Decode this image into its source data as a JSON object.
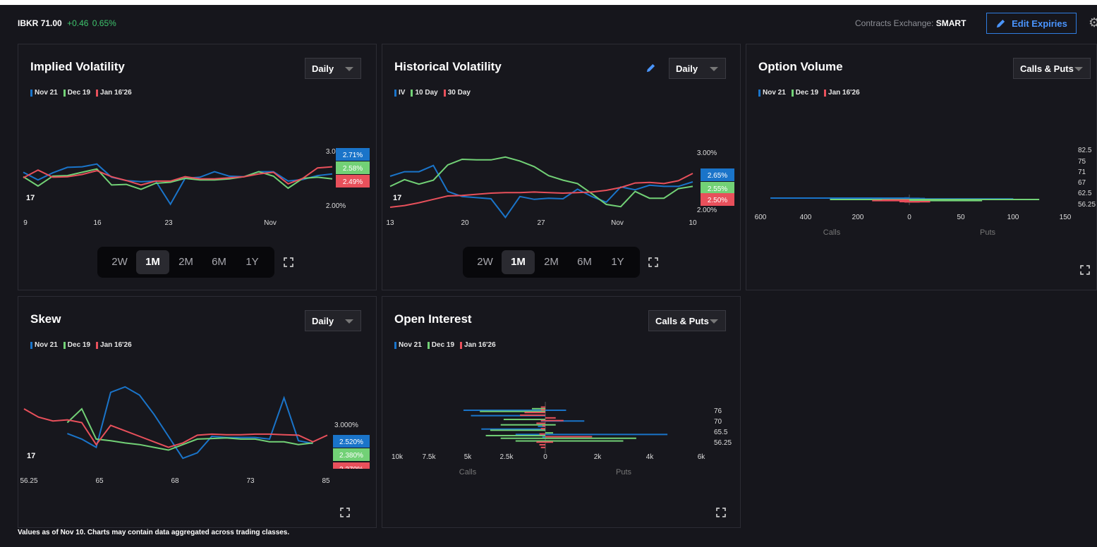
{
  "ticker": {
    "symbol": "IBKR",
    "price": "71.00",
    "change": "+0.46",
    "change_pct": "0.65%"
  },
  "exchange": {
    "label": "Contracts Exchange:",
    "value": "SMART"
  },
  "edit_expiries": "Edit Expiries",
  "footer": "Values as of Nov 10. Charts may contain data aggregated across trading classes.",
  "colors": {
    "blue": "#1a74c9",
    "green": "#72d176",
    "red": "#e8505b",
    "background": "#16161c"
  },
  "icons": [
    "pencil-icon",
    "gear-icon",
    "caret-down-icon",
    "expand-icon",
    "tradingview-logo"
  ],
  "panels": {
    "iv": {
      "title": "Implied Volatility",
      "dropdown": "Daily",
      "legend": [
        "Nov 21",
        "Dec 19",
        "Jan 16'26"
      ],
      "ranges": [
        "2W",
        "1M",
        "2M",
        "6M",
        "1Y"
      ],
      "active_range": "1M"
    },
    "hv": {
      "title": "Historical Volatility",
      "dropdown": "Daily",
      "legend": [
        "IV",
        "10 Day",
        "30 Day"
      ],
      "ranges": [
        "2W",
        "1M",
        "2M",
        "6M",
        "1Y"
      ],
      "active_range": "1M"
    },
    "ov": {
      "title": "Option Volume",
      "dropdown": "Calls & Puts",
      "legend": [
        "Nov 21",
        "Dec 19",
        "Jan 16'26"
      ]
    },
    "skew": {
      "title": "Skew",
      "dropdown": "Daily",
      "legend": [
        "Nov 21",
        "Dec 19",
        "Jan 16'26"
      ]
    },
    "oi": {
      "title": "Open Interest",
      "dropdown": "Calls & Puts",
      "legend": [
        "Nov 21",
        "Dec 19",
        "Jan 16'26"
      ]
    }
  },
  "chart_data": [
    {
      "id": "iv",
      "type": "line",
      "title": "Implied Volatility",
      "x_ticks": [
        "9",
        "16",
        "23",
        "Nov"
      ],
      "y_ticks": [
        "3.00%",
        "2.00%"
      ],
      "last_labels": [
        "2.71%",
        "2.58%",
        "2.49%"
      ],
      "series": [
        {
          "name": "Nov 21",
          "color": "#1a74c9",
          "values": [
            2.61,
            2.47,
            2.6,
            2.7,
            2.71,
            2.76,
            2.52,
            2.46,
            2.44,
            2.45,
            2.03,
            2.5,
            2.52,
            2.62,
            2.54,
            2.53,
            2.62,
            2.62,
            2.45,
            2.48,
            2.55,
            2.58
          ]
        },
        {
          "name": "Dec 19",
          "color": "#72d176",
          "values": [
            2.53,
            2.36,
            2.54,
            2.55,
            2.61,
            2.67,
            2.38,
            2.39,
            2.3,
            2.41,
            2.43,
            2.5,
            2.47,
            2.47,
            2.49,
            2.53,
            2.62,
            2.54,
            2.32,
            2.5,
            2.52,
            2.49
          ]
        },
        {
          "name": "Jan 16'26",
          "color": "#e8505b",
          "values": [
            2.51,
            2.65,
            2.52,
            2.53,
            2.57,
            2.64,
            2.53,
            2.46,
            2.38,
            2.45,
            2.45,
            2.53,
            2.49,
            2.49,
            2.51,
            2.53,
            2.58,
            2.61,
            2.4,
            2.5,
            2.69,
            2.71
          ]
        }
      ]
    },
    {
      "id": "hv",
      "type": "line",
      "title": "Historical Volatility",
      "x_ticks": [
        "13",
        "20",
        "27",
        "Nov",
        "10"
      ],
      "y_ticks": [
        "3.00%",
        "2.00%"
      ],
      "last_labels": [
        "2.65%",
        "2.55%",
        "2.50%"
      ],
      "series": [
        {
          "name": "IV",
          "color": "#1a74c9",
          "values": [
            2.6,
            2.68,
            2.68,
            2.79,
            2.33,
            2.24,
            2.22,
            2.2,
            1.87,
            2.24,
            2.19,
            2.21,
            2.2,
            2.37,
            2.24,
            2.14,
            2.41,
            2.36,
            2.44,
            2.42,
            2.42,
            2.5
          ]
        },
        {
          "name": "10 Day",
          "color": "#72d176",
          "values": [
            2.42,
            2.54,
            2.46,
            2.53,
            2.8,
            2.9,
            2.89,
            2.89,
            2.94,
            2.87,
            2.77,
            2.61,
            2.53,
            2.47,
            2.29,
            2.1,
            2.06,
            2.33,
            2.21,
            2.21,
            2.38,
            2.42
          ]
        },
        {
          "name": "30 Day",
          "color": "#e8505b",
          "values": [
            2.05,
            2.08,
            2.13,
            2.19,
            2.25,
            2.26,
            2.28,
            2.3,
            2.31,
            2.31,
            2.32,
            2.31,
            2.3,
            2.31,
            2.32,
            2.35,
            2.4,
            2.48,
            2.49,
            2.47,
            2.52,
            2.65
          ]
        }
      ]
    },
    {
      "id": "ov",
      "type": "bar",
      "title": "Option Volume",
      "orientation": "horizontal",
      "x_ticks_calls": [
        "600",
        "400",
        "200",
        "0"
      ],
      "x_ticks_puts": [
        "50",
        "100",
        "150"
      ],
      "strike_labels": [
        "82.5",
        "75",
        "71",
        "67",
        "62.5",
        "56.25"
      ],
      "xlabel_left": "Calls",
      "xlabel_right": "Puts",
      "calls_max": 600,
      "puts_max": 150,
      "strikes": [
        82.5,
        80,
        77.5,
        75,
        72.5,
        71,
        70,
        69,
        68,
        67,
        66,
        65,
        64,
        62.5,
        60,
        56.25
      ],
      "series": [
        {
          "name": "Nov 21",
          "color": "#1a74c9",
          "calls": [
            0,
            0,
            20,
            560,
            40,
            30,
            10,
            10,
            0,
            5,
            10,
            5,
            10,
            0,
            0,
            0
          ],
          "puts": [
            0,
            0,
            0,
            0,
            0,
            10,
            15,
            5,
            5,
            100,
            10,
            60,
            45,
            10,
            0,
            0
          ]
        },
        {
          "name": "Dec 19",
          "color": "#72d176",
          "calls": [
            0,
            0,
            0,
            0,
            0,
            320,
            0,
            0,
            0,
            0,
            0,
            0,
            70,
            0,
            0,
            0
          ],
          "puts": [
            0,
            0,
            0,
            0,
            0,
            125,
            20,
            0,
            0,
            0,
            0,
            0,
            50,
            70,
            0,
            0
          ]
        },
        {
          "name": "Jan 16'26",
          "color": "#e8505b",
          "calls": [
            0,
            80,
            110,
            20,
            0,
            150,
            0,
            0,
            10,
            0,
            5,
            0,
            40,
            0,
            20,
            0
          ],
          "puts": [
            0,
            0,
            0,
            0,
            0,
            0,
            0,
            0,
            0,
            0,
            0,
            0,
            20,
            20,
            10,
            0
          ]
        }
      ]
    },
    {
      "id": "skew",
      "type": "line",
      "title": "Skew",
      "x_ticks": [
        "56.25",
        "65",
        "68",
        "73",
        "85"
      ],
      "y_ticks": [
        "3.000%"
      ],
      "last_labels": [
        "2.520%",
        "2.380%",
        "2.370%"
      ],
      "series": [
        {
          "name": "Nov 21",
          "color": "#1a74c9",
          "values": [
            null,
            null,
            null,
            2.55,
            2.45,
            2.3,
            3.3,
            3.4,
            3.25,
            2.9,
            2.5,
            2.1,
            2.2,
            2.5,
            2.48,
            2.48,
            2.48,
            2.45,
            3.2,
            2.42,
            2.37,
            null
          ]
        },
        {
          "name": "Dec 19",
          "color": "#72d176",
          "values": [
            null,
            null,
            null,
            2.75,
            3.0,
            2.45,
            2.42,
            2.38,
            2.35,
            2.3,
            2.25,
            2.35,
            2.45,
            2.46,
            2.47,
            2.45,
            2.45,
            2.4,
            2.4,
            2.35,
            2.38,
            null
          ]
        },
        {
          "name": "Jan 16'26",
          "color": "#e8505b",
          "values": [
            3.0,
            2.85,
            2.78,
            2.8,
            2.75,
            2.35,
            2.7,
            2.6,
            2.5,
            2.4,
            2.3,
            2.38,
            2.52,
            2.54,
            2.53,
            2.53,
            2.54,
            2.54,
            2.53,
            2.52,
            2.4,
            2.52
          ]
        }
      ]
    },
    {
      "id": "oi",
      "type": "bar",
      "title": "Open Interest",
      "orientation": "horizontal",
      "x_ticks_calls": [
        "10k",
        "7.5k",
        "5k",
        "2.5k",
        "0"
      ],
      "x_ticks_puts": [
        "2k",
        "4k",
        "6k"
      ],
      "strike_labels": [
        "76",
        "70",
        "65.5",
        "56.25"
      ],
      "xlabel_left": "Calls",
      "xlabel_right": "Puts",
      "calls_max": 10000,
      "puts_max": 6000,
      "strikes": [
        80,
        78,
        76,
        74,
        72,
        71,
        70,
        69,
        68,
        67,
        66,
        65.5,
        64,
        62,
        60,
        58,
        56.25
      ],
      "series": [
        {
          "name": "Nov 21",
          "color": "#1a74c9",
          "calls": [
            0,
            0,
            5500,
            0,
            5000,
            0,
            300,
            0,
            500,
            4300,
            0,
            2000,
            200,
            0,
            0,
            0,
            0
          ],
          "puts": [
            0,
            0,
            800,
            0,
            0,
            0,
            1500,
            0,
            0,
            0,
            0,
            4700,
            0,
            0,
            0,
            0,
            0
          ]
        },
        {
          "name": "Dec 19",
          "color": "#72d176",
          "calls": [
            0,
            900,
            4400,
            0,
            0,
            2800,
            0,
            3000,
            0,
            3700,
            0,
            4000,
            3000,
            2000,
            0,
            0,
            0
          ],
          "puts": [
            0,
            0,
            0,
            0,
            0,
            0,
            0,
            400,
            0,
            0,
            300,
            0,
            3500,
            3000,
            0,
            0,
            0
          ]
        },
        {
          "name": "Jan 16'26",
          "color": "#e8505b",
          "calls": [
            300,
            300,
            1400,
            1700,
            0,
            300,
            600,
            200,
            300,
            0,
            400,
            0,
            0,
            600,
            400,
            300,
            0
          ],
          "puts": [
            0,
            0,
            0,
            0,
            400,
            700,
            0,
            0,
            0,
            0,
            0,
            1800,
            0,
            300,
            0,
            0,
            0
          ]
        }
      ]
    }
  ]
}
